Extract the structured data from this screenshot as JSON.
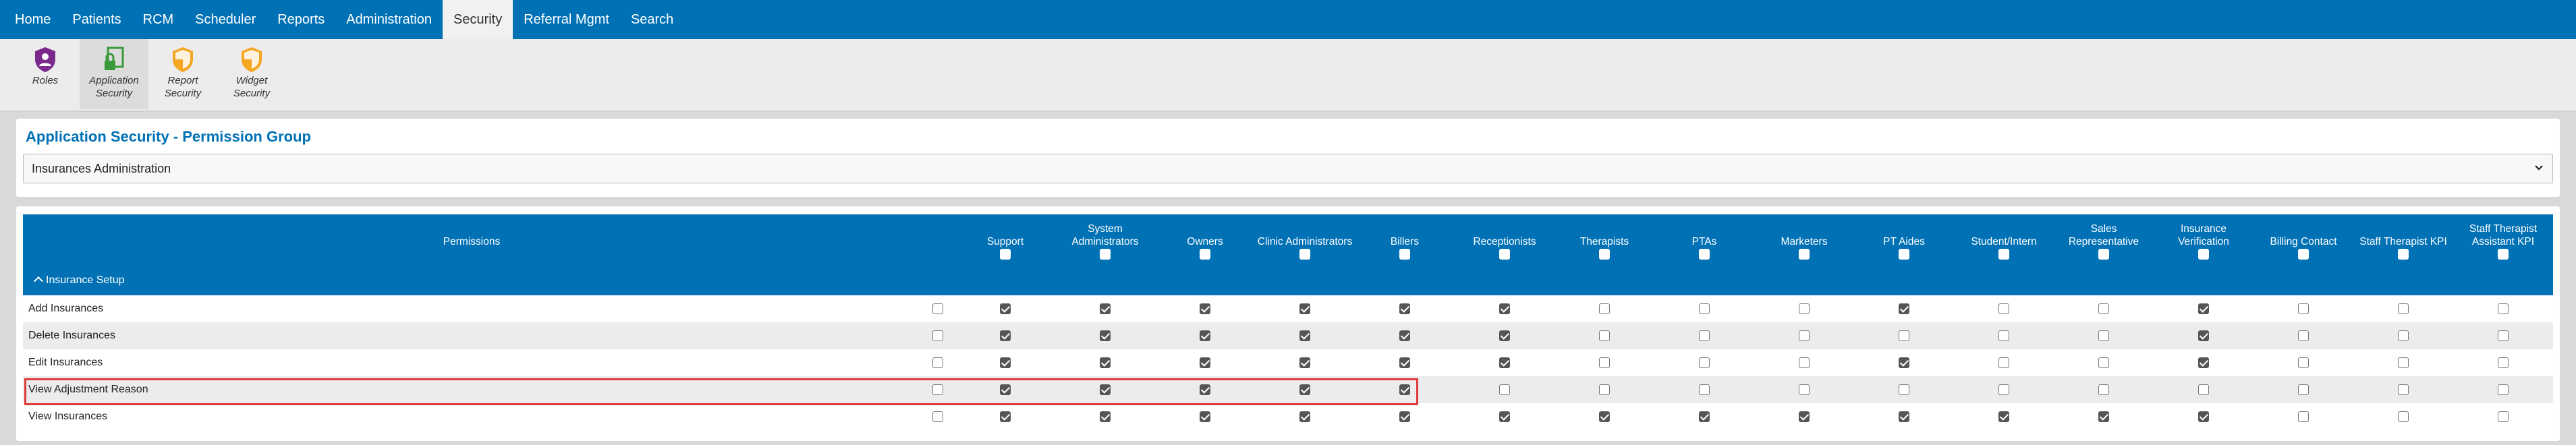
{
  "nav": {
    "items": [
      "Home",
      "Patients",
      "RCM",
      "Scheduler",
      "Reports",
      "Administration",
      "Security",
      "Referral Mgmt",
      "Search"
    ],
    "active": "Security"
  },
  "toolbar": {
    "tools": [
      {
        "label_line1": "Roles",
        "label_line2": "",
        "icon": "roles-icon",
        "color": "#7b2a8c"
      },
      {
        "label_line1": "Application",
        "label_line2": "Security",
        "icon": "lock-icon",
        "color": "#3a9a3a"
      },
      {
        "label_line1": "Report",
        "label_line2": "Security",
        "icon": "shield-icon",
        "color": "#f5a623"
      },
      {
        "label_line1": "Widget",
        "label_line2": "Security",
        "icon": "shield-icon",
        "color": "#f5a623"
      }
    ]
  },
  "page": {
    "title": "Application Security - Permission Group",
    "selected_group": "Insurances Administration"
  },
  "table": {
    "permissions_header": "Permissions",
    "columns": [
      "Support",
      "System Administrators",
      "Owners",
      "Clinic Administrators",
      "Billers",
      "Receptionists",
      "Therapists",
      "PTAs",
      "Marketers",
      "PT Aides",
      "Student/Intern",
      "Sales Representative",
      "Insurance Verification",
      "Billing Contact",
      "Staff Therapist KPI",
      "Staff Therapist Assistant KPI"
    ],
    "section": "Insurance Setup",
    "rows": [
      {
        "name": "Add Insurances",
        "row_check": false,
        "values": [
          true,
          true,
          true,
          true,
          true,
          true,
          false,
          false,
          false,
          true,
          false,
          false,
          true,
          false,
          false,
          false
        ]
      },
      {
        "name": "Delete Insurances",
        "row_check": false,
        "values": [
          true,
          true,
          true,
          true,
          true,
          true,
          false,
          false,
          false,
          false,
          false,
          false,
          true,
          false,
          false,
          false
        ]
      },
      {
        "name": "Edit Insurances",
        "row_check": false,
        "values": [
          true,
          true,
          true,
          true,
          true,
          true,
          false,
          false,
          false,
          true,
          false,
          false,
          true,
          false,
          false,
          false
        ]
      },
      {
        "name": "View Adjustment Reason",
        "row_check": false,
        "values": [
          true,
          true,
          true,
          true,
          true,
          false,
          false,
          false,
          false,
          false,
          false,
          false,
          false,
          false,
          false,
          false
        ]
      },
      {
        "name": "View Insurances",
        "row_check": false,
        "values": [
          true,
          true,
          true,
          true,
          true,
          true,
          true,
          true,
          true,
          true,
          true,
          true,
          true,
          false,
          false,
          false
        ]
      }
    ]
  }
}
